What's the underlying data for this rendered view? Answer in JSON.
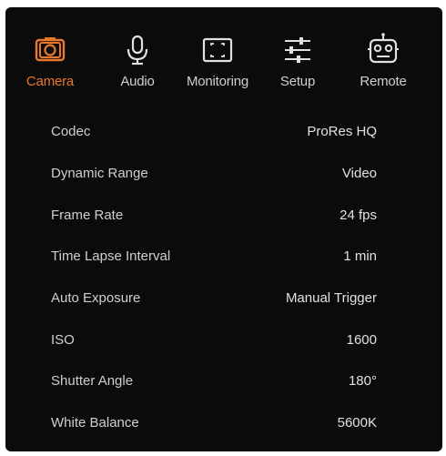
{
  "colors": {
    "accent": "#e8792c",
    "panel_bg": "#0b0b0b",
    "text": "#d8d8d8"
  },
  "tabs": [
    {
      "label": "Camera",
      "icon": "camera-icon",
      "active": true
    },
    {
      "label": "Audio",
      "icon": "microphone-icon",
      "active": false
    },
    {
      "label": "Monitoring",
      "icon": "monitoring-frame-icon",
      "active": false
    },
    {
      "label": "Setup",
      "icon": "sliders-icon",
      "active": false
    },
    {
      "label": "Remote",
      "icon": "robot-remote-icon",
      "active": false
    }
  ],
  "settings": [
    {
      "name": "Codec",
      "value": "ProRes HQ"
    },
    {
      "name": "Dynamic Range",
      "value": "Video"
    },
    {
      "name": "Frame Rate",
      "value": "24 fps"
    },
    {
      "name": "Time Lapse Interval",
      "value": "1 min"
    },
    {
      "name": "Auto Exposure",
      "value": "Manual Trigger"
    },
    {
      "name": "ISO",
      "value": "1600"
    },
    {
      "name": "Shutter Angle",
      "value": "180°"
    },
    {
      "name": "White Balance",
      "value": "5600K"
    }
  ]
}
